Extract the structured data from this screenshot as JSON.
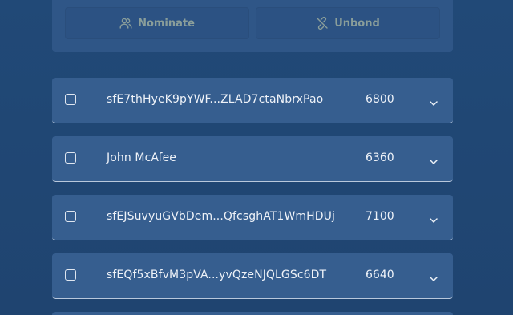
{
  "actions": {
    "nominate_label": "Nominate",
    "unbond_label": "Unbond"
  },
  "validators": [
    {
      "name": "sfE7thHyeK9pYWF...ZLAD7ctaNbrxPao",
      "value": "6800"
    },
    {
      "name": "John McAfee",
      "value": "6360"
    },
    {
      "name": "sfEJSuvyuGVbDem...QfcsghAT1WmHDUj",
      "value": "7100"
    },
    {
      "name": "sfEQf5xBfvM3pVA...yvQzeNJQLGSc6DT",
      "value": "6640"
    }
  ],
  "colors": {
    "background": "#214672",
    "panel": "#2f5687",
    "row": "#365e8f",
    "button_text": "#8a9e9a",
    "row_text": "#eef2f8"
  },
  "icons": {
    "nominate": "users-icon",
    "unbond": "unlink-icon",
    "row_expand": "chevron-down-icon"
  }
}
